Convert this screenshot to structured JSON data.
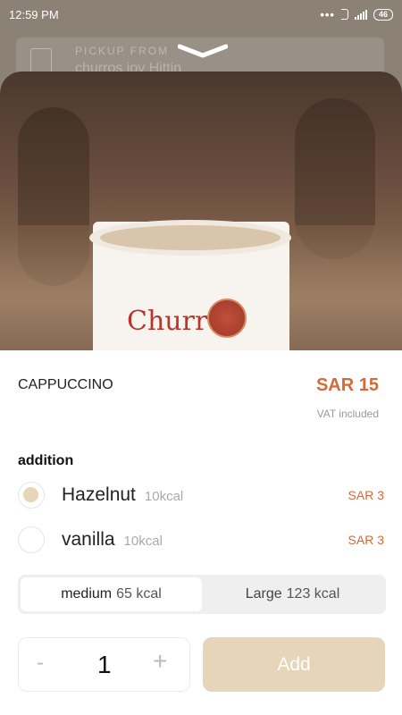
{
  "status_bar": {
    "time": "12:59 PM",
    "battery": "46"
  },
  "background": {
    "pickup_label": "PICKUP FROM",
    "pickup_value": "churros joy Hittin"
  },
  "product": {
    "name": "CAPPUCCINO",
    "price": "SAR 15",
    "vat_note": "VAT included",
    "image_brand": "Churr",
    "image_alt": "cappuccino cup"
  },
  "additions": {
    "label": "addition",
    "options": [
      {
        "name": "Hazelnut",
        "kcal": "10kcal",
        "price": "SAR 3",
        "selected": true
      },
      {
        "name": "vanilla",
        "kcal": "10kcal",
        "price": "SAR 3",
        "selected": false
      }
    ]
  },
  "sizes": [
    {
      "name": "medium",
      "kcal": "65 kcal",
      "active": true
    },
    {
      "name": "Large",
      "kcal": "123 kcal",
      "active": false
    }
  ],
  "quantity": {
    "minus": "-",
    "value": "1",
    "plus": "+"
  },
  "add_button": "Add",
  "colors": {
    "accent": "#d4693a",
    "button": "#e6d5b8",
    "radio_fill": "#e6d5b8"
  }
}
